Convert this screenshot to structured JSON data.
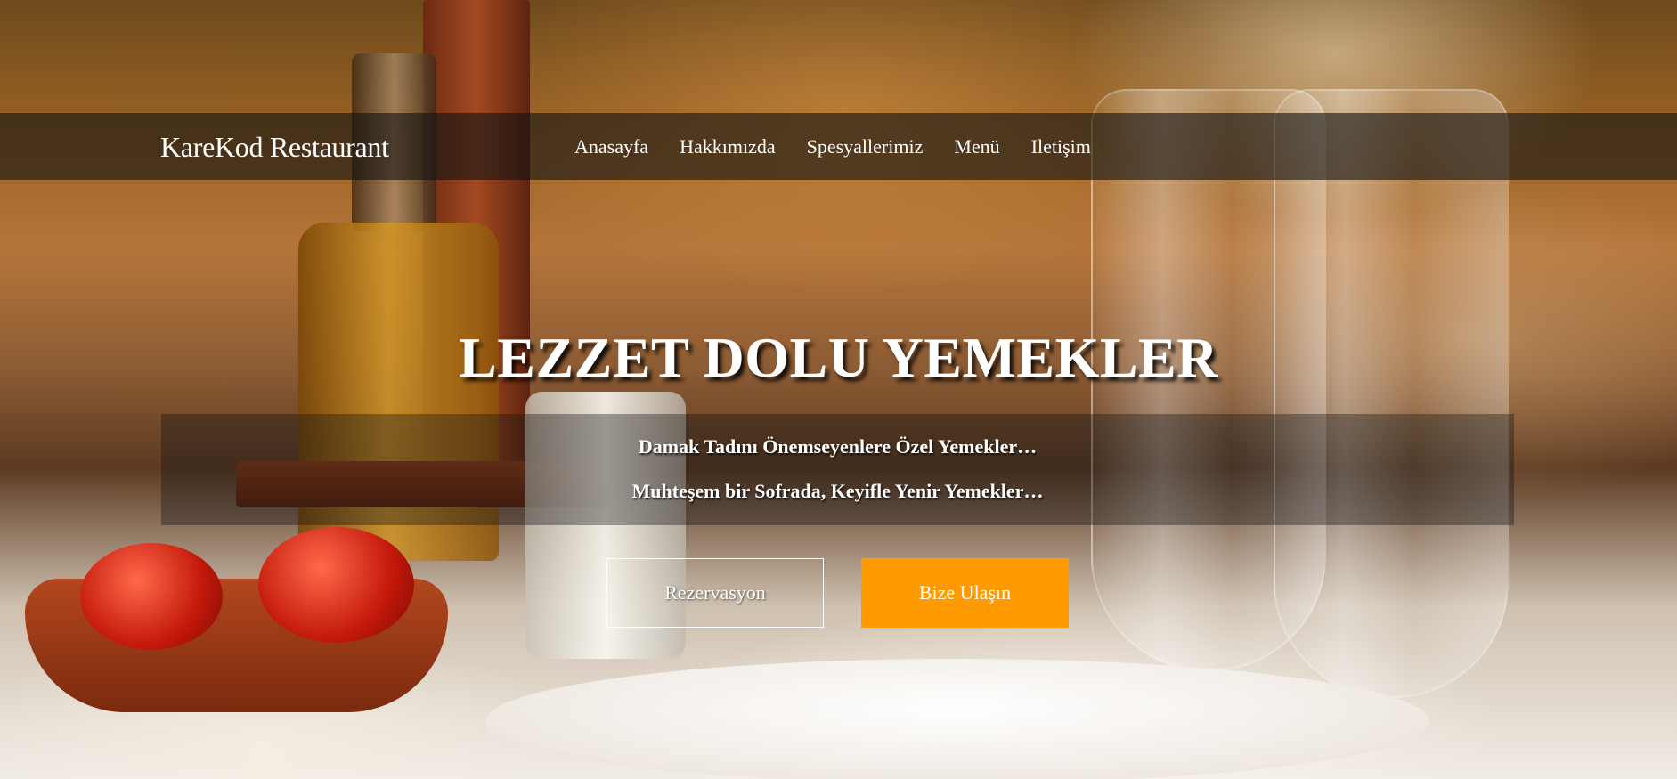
{
  "header": {
    "brand": "KareKod Restaurant",
    "nav_items": [
      {
        "label": "Anasayfa"
      },
      {
        "label": "Hakkımızda"
      },
      {
        "label": "Spesyallerimiz"
      },
      {
        "label": "Menü"
      },
      {
        "label": "Iletişim"
      }
    ]
  },
  "hero": {
    "headline": "LEZZET DOLU YEMEKLER",
    "taglines": [
      "Damak Tadını Önemseyenlere Özel Yemekler…",
      "Muhteşem bir Sofrada, Keyifle Yenir Yemekler…"
    ],
    "buttons": {
      "reservation": "Rezervasyon",
      "contact": "Bize Ulaşın"
    }
  },
  "colors": {
    "accent": "#ff9a00",
    "navbar_bg": "#141414",
    "text": "#ffffff"
  }
}
